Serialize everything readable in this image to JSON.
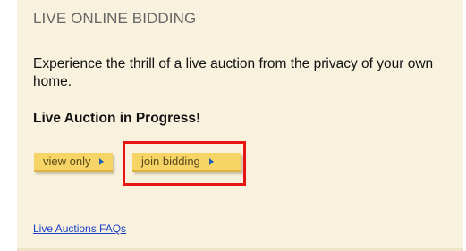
{
  "panel": {
    "heading": "LIVE ONLINE BIDDING",
    "description": "Experience the thrill of a live auction from the privacy of your own home.",
    "status": "Live Auction in Progress!",
    "buttons": {
      "view_only": "view only",
      "join_bidding": "join bidding"
    },
    "faq_link": "Live Auctions FAQs"
  },
  "icons": {
    "button_arrow": "triangle-right-icon"
  },
  "colors": {
    "panel_background": "#f7f1de",
    "button_background": "#f6d466",
    "highlight_border": "#e81414",
    "link": "#1a3fc8"
  }
}
